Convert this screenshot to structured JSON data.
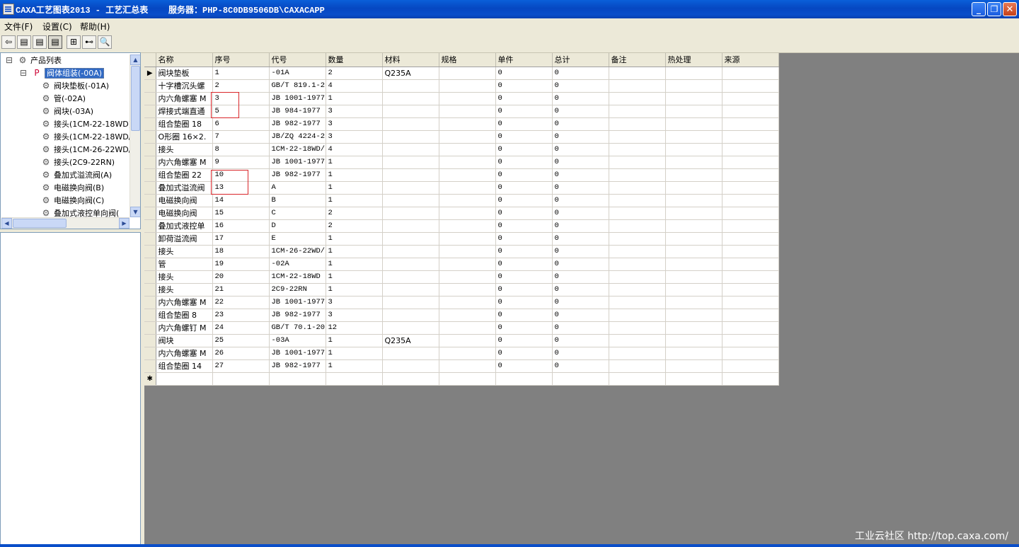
{
  "window": {
    "title": "CAXA工艺图表2013 - 工艺汇总表    服务器：PHP-8C0DB9506DB\\CAXACAPP",
    "buttons": {
      "minimize": "_",
      "restore": "❐",
      "close": "✕"
    }
  },
  "menu": {
    "file": "文件(F)",
    "settings": "设置(C)",
    "help": "帮助(H)"
  },
  "toolbar": {
    "icons": [
      "back-arrow-icon",
      "table-view-icon",
      "table-view-icon",
      "table-view-icon",
      "tree-sync-icon",
      "tree-structure-icon",
      "search-icon"
    ]
  },
  "tree": {
    "root": "产品列表",
    "assembly": "阀体组装(-00A)",
    "children": [
      "阀块垫板(-01A)",
      "管(-02A)",
      "阀块(-03A)",
      "接头(1CM-22-18WD)",
      "接头(1CM-22-18WD/",
      "接头(1CM-26-22WD/",
      "接头(2C9-22RN)",
      "叠加式溢流阀(A)",
      "电磁换向阀(B)",
      "电磁换向阀(C)",
      "叠加式液控单向阀("
    ]
  },
  "grid": {
    "columns": [
      "名称",
      "序号",
      "代号",
      "数量",
      "材料",
      "规格",
      "单件",
      "总计",
      "备注",
      "热处理",
      "来源"
    ],
    "rows": [
      [
        "阀块垫板",
        "1",
        "-01A",
        "2",
        "Q235A",
        "",
        "0",
        "0",
        "",
        "",
        ""
      ],
      [
        "十字槽沉头螺",
        "2",
        "GB/T 819.1-2",
        "4",
        "",
        "",
        "0",
        "0",
        "",
        "",
        ""
      ],
      [
        "内六角螺塞 M",
        "3",
        "JB 1001-1977",
        "1",
        "",
        "",
        "0",
        "0",
        "",
        "",
        ""
      ],
      [
        "焊接式端直通",
        "5",
        "JB 984-1977",
        "3",
        "",
        "",
        "0",
        "0",
        "",
        "",
        ""
      ],
      [
        "组合垫圈 18",
        "6",
        "JB 982-1977",
        "3",
        "",
        "",
        "0",
        "0",
        "",
        "",
        ""
      ],
      [
        "O形圈 16×2.",
        "7",
        "JB/ZQ 4224-2",
        "3",
        "",
        "",
        "0",
        "0",
        "",
        "",
        ""
      ],
      [
        "接头",
        "8",
        "1CM-22-18WD/",
        "4",
        "",
        "",
        "0",
        "0",
        "",
        "",
        ""
      ],
      [
        "内六角螺塞 M",
        "9",
        "JB 1001-1977",
        "1",
        "",
        "",
        "0",
        "0",
        "",
        "",
        ""
      ],
      [
        "组合垫圈 22",
        "10",
        "JB 982-1977",
        "1",
        "",
        "",
        "0",
        "0",
        "",
        "",
        ""
      ],
      [
        "叠加式溢流阀",
        "13",
        "A",
        "1",
        "",
        "",
        "0",
        "0",
        "",
        "",
        ""
      ],
      [
        "电磁换向阀",
        "14",
        "B",
        "1",
        "",
        "",
        "0",
        "0",
        "",
        "",
        ""
      ],
      [
        "电磁换向阀",
        "15",
        "C",
        "2",
        "",
        "",
        "0",
        "0",
        "",
        "",
        ""
      ],
      [
        "叠加式液控单",
        "16",
        "D",
        "2",
        "",
        "",
        "0",
        "0",
        "",
        "",
        ""
      ],
      [
        "卸荷溢流阀",
        "17",
        "E",
        "1",
        "",
        "",
        "0",
        "0",
        "",
        "",
        ""
      ],
      [
        "接头",
        "18",
        "1CM-26-22WD/",
        "1",
        "",
        "",
        "0",
        "0",
        "",
        "",
        ""
      ],
      [
        "管",
        "19",
        "-02A",
        "1",
        "",
        "",
        "0",
        "0",
        "",
        "",
        ""
      ],
      [
        "接头",
        "20",
        "1CM-22-18WD",
        "1",
        "",
        "",
        "0",
        "0",
        "",
        "",
        ""
      ],
      [
        "接头",
        "21",
        "2C9-22RN",
        "1",
        "",
        "",
        "0",
        "0",
        "",
        "",
        ""
      ],
      [
        "内六角螺塞 M",
        "22",
        "JB 1001-1977",
        "3",
        "",
        "",
        "0",
        "0",
        "",
        "",
        ""
      ],
      [
        "组合垫圈 8",
        "23",
        "JB 982-1977",
        "3",
        "",
        "",
        "0",
        "0",
        "",
        "",
        ""
      ],
      [
        "内六角螺钉 M",
        "24",
        "GB/T 70.1-20",
        "12",
        "",
        "",
        "0",
        "0",
        "",
        "",
        ""
      ],
      [
        "阀块",
        "25",
        "-03A",
        "1",
        "Q235A",
        "",
        "0",
        "0",
        "",
        "",
        ""
      ],
      [
        "内六角螺塞 M",
        "26",
        "JB 1001-1977",
        "1",
        "",
        "",
        "0",
        "0",
        "",
        "",
        ""
      ],
      [
        "组合垫圈 14",
        "27",
        "JB 982-1977",
        "1",
        "",
        "",
        "0",
        "0",
        "",
        "",
        ""
      ]
    ],
    "current_row_marker": "▶",
    "new_row_marker": "✱"
  },
  "watermark": "工业云社区 http://top.caxa.com/",
  "colors": {
    "title_blue": "#0a4ec9",
    "highlight_red": "#d9262a",
    "selection": "#316ac5"
  }
}
